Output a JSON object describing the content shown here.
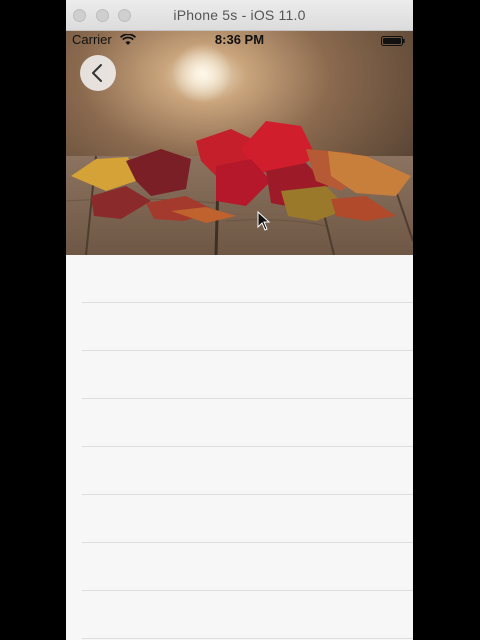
{
  "window": {
    "title": "iPhone 5s - iOS 11.0"
  },
  "status_bar": {
    "carrier": "Carrier",
    "time": "8:36 PM",
    "icons": [
      "wifi-icon",
      "battery-icon"
    ]
  },
  "navigation": {
    "back_icon": "chevron-left-icon"
  },
  "header_image": {
    "subject": "autumn-leaves-on-wooden-table"
  },
  "table": {
    "rows": [
      "",
      "",
      "",
      "",
      "",
      "",
      "",
      ""
    ]
  }
}
